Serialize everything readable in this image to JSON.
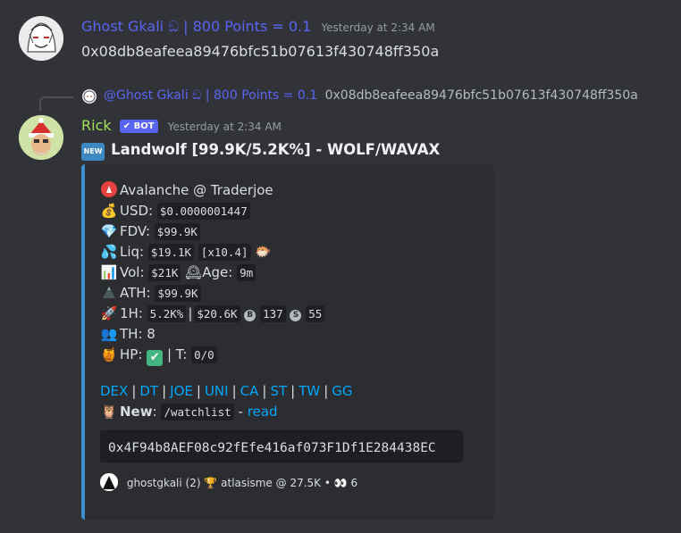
{
  "message1": {
    "author": "Ghost Gkali ඞ | 800 Points = 0.1",
    "timestamp": "Yesterday at 2:34 AM",
    "content": "0x08db8eafeea89476bfc51b07613f430748ff350a"
  },
  "reply_ref": {
    "author": "@Ghost Gkali ඞ | 800 Points = 0.1",
    "content": "0x08db8eafeea89476bfc51b07613f430748ff350a"
  },
  "message2": {
    "author": "Rick",
    "bot_badge": "BOT",
    "timestamp": "Yesterday at 2:34 AM",
    "new_badge": "NEW",
    "title": "Landwolf [99.9K/5.2K%] - WOLF/WAVAX"
  },
  "embed": {
    "chain_line": "Avalanche @ Traderjoe",
    "usd_label": "USD:",
    "usd_value": "$0.0000001447",
    "fdv_label": "FDV:",
    "fdv_value": "$99.9K",
    "liq_label": "Liq:",
    "liq_value": "$19.1K",
    "liq_mult": "[x10.4]",
    "vol_label": "Vol:",
    "vol_value": "$21K",
    "age_label": "Age:",
    "age_value": "9m",
    "ath_label": "ATH:",
    "ath_value": "$99.9K",
    "h1_label": "1H:",
    "h1_pct": "5.2K%",
    "h1_vol": "$20.6K",
    "h1_buys": "137",
    "h1_sells": "55",
    "th_label": "TH: 8",
    "hp_label": "HP:",
    "hp_sep": "| T:",
    "hp_t_value": "0/0",
    "links": [
      "DEX",
      "DT",
      "JOE",
      "UNI",
      "CA",
      "ST",
      "TW",
      "GG"
    ],
    "new_label": "New",
    "new_colon": ":",
    "watchlist_cmd": "/watchlist",
    "dash": "-",
    "read_link": "read",
    "contract": "0x4F94b8AEF08c92fEfe416af073F1Df1E284438EC",
    "footer_text": "ghostgkali (2)",
    "footer_text2": "atlasisme @ 27.5K •",
    "footer_count": "6"
  },
  "colors": {
    "background": "#313338",
    "embed_bg": "#2b2d31",
    "embed_border": "#3e8ed0",
    "author1": "#5865f2",
    "author2": "#a3e05a",
    "link": "#00a8fc",
    "bot_badge": "#5865f2"
  }
}
